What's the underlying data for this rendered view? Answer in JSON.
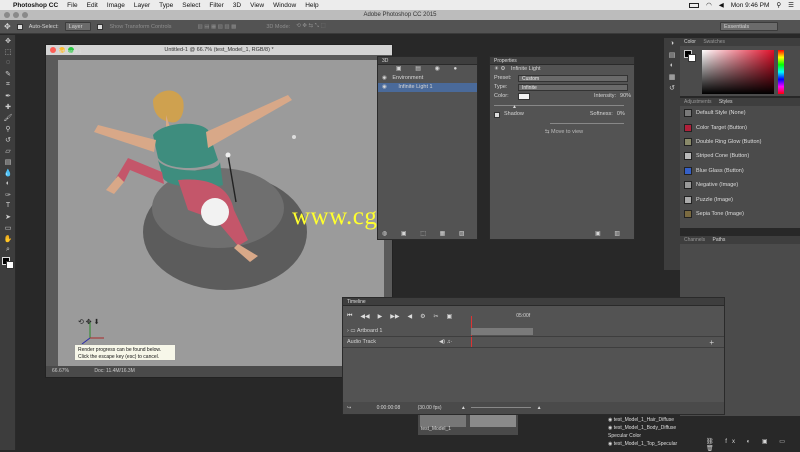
{
  "menubar": {
    "app": "Photoshop CC",
    "items": [
      "File",
      "Edit",
      "Image",
      "Layer",
      "Type",
      "Select",
      "Filter",
      "3D",
      "View",
      "Window",
      "Help"
    ],
    "time": "Mon 9:46 PM"
  },
  "titlebar": {
    "title": "Adobe Photoshop CC 2015"
  },
  "options": {
    "auto_select_label": "Auto-Select:",
    "auto_select_value": "Layer",
    "show_transform": "Show Transform Controls",
    "mode_3d": "3D Mode:",
    "workspace": "Essentials"
  },
  "document": {
    "title": "Untitled-1 @ 66.7% (test_Model_1, RGB/8) *",
    "artboard_label": "Artboard 1",
    "zoom": "66.67%",
    "doc_size": "Doc: 11.4M/16.3M"
  },
  "tooltip": {
    "line1": "Render progress can be found below.",
    "line2": "Click the escape key (esc) to cancel."
  },
  "panel3d": {
    "tab": "3D",
    "items": [
      "Environment",
      "Infinite Light 1"
    ]
  },
  "properties": {
    "tab": "Properties",
    "header": "Infinite Light",
    "preset_label": "Preset:",
    "preset_value": "Custom",
    "type_label": "Type:",
    "type_value": "Infinite",
    "color_label": "Color:",
    "intensity_label": "Intensity:",
    "intensity_value": "90%",
    "shadow_label": "Shadow",
    "softness_label": "Softness:",
    "softness_value": "0%",
    "move_to_view": "Move to view"
  },
  "color_panel": {
    "tabs": [
      "Color",
      "Swatches"
    ]
  },
  "styles_panel": {
    "tabs": [
      "Adjustments",
      "Styles"
    ],
    "items": [
      {
        "label": "Default Style (None)",
        "color": "#7a7a7a"
      },
      {
        "label": "Color Target (Button)",
        "color": "#b0203a"
      },
      {
        "label": "Double Ring Glow (Button)",
        "color": "#8a8a6a"
      },
      {
        "label": "Striped Cone (Button)",
        "color": "#bbbbbb"
      },
      {
        "label": "Blue Glass (Button)",
        "color": "#3560c8"
      },
      {
        "label": "Negative (Image)",
        "color": "#9a9a9a"
      },
      {
        "label": "Puzzle (Image)",
        "color": "#aaaaaa"
      },
      {
        "label": "Sepia Tone (Image)",
        "color": "#7a6a40"
      }
    ]
  },
  "channels_panel": {
    "tabs": [
      "Channels",
      "Paths"
    ]
  },
  "timeline": {
    "tab": "Timeline",
    "timecode": "0:00:00:08",
    "fps": "(30.00 fps)",
    "ruler_label": "05:00f",
    "track1": "Artboard 1",
    "track2": "Audio Track",
    "clip_label": "test_Model_1"
  },
  "layers": {
    "items": [
      "test_Model_1_Hair_Diffuse",
      "test_Model_1_Body_Diffuse",
      "Specular Color",
      "test_Model_1_Top_Specular"
    ]
  },
  "watermark": "www.cg-ku.com",
  "colors": {
    "watermark": "#ffff2e",
    "shirt": "#3e8d7e",
    "pants": "#c4566a",
    "skin": "#d8a888",
    "hair": "#cfa14f"
  }
}
